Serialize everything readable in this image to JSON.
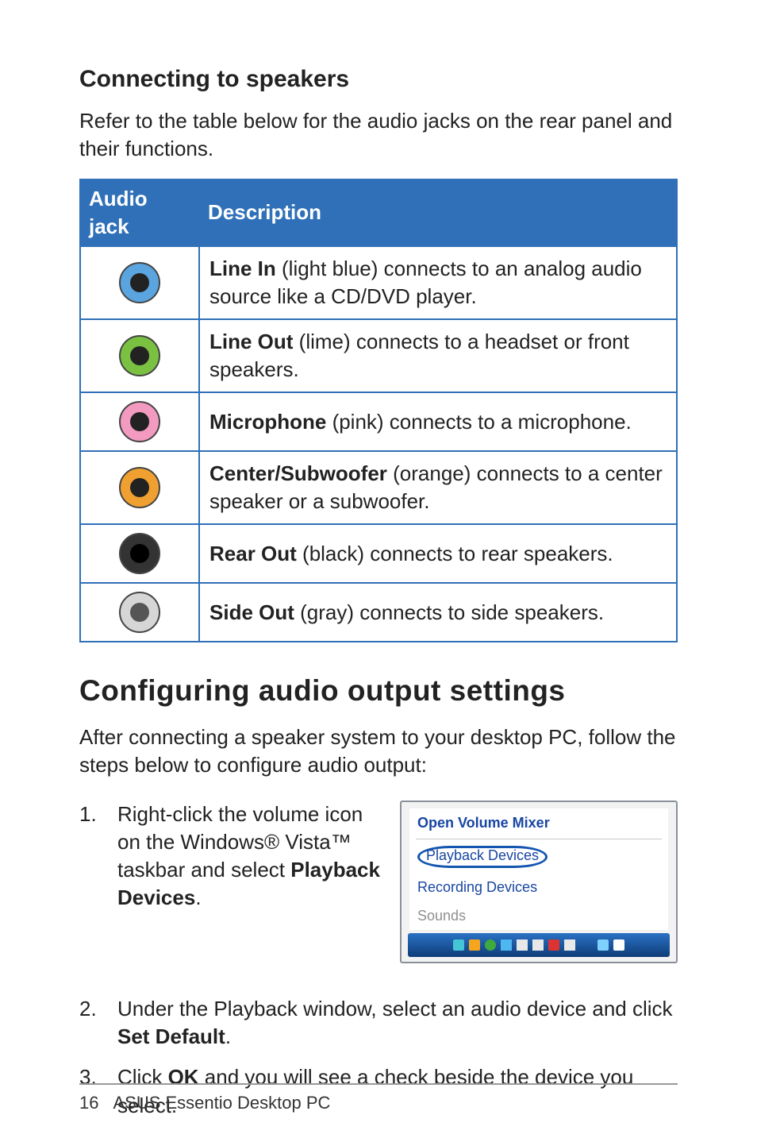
{
  "headings": {
    "connecting": "Connecting to speakers",
    "configuring": "Configuring audio output settings"
  },
  "paragraphs": {
    "refer": "Refer to the table below for the audio jacks on the rear panel and their functions.",
    "after": "After connecting a speaker system to your desktop PC, follow the steps below to configure audio output:"
  },
  "table": {
    "col_jack": "Audio jack",
    "col_desc": "Description",
    "rows": [
      {
        "bold": "Line In",
        "rest": " (light blue) connects to an analog audio source like a CD/DVD player."
      },
      {
        "bold": "Line Out",
        "rest": " (lime) connects to a headset or front speakers."
      },
      {
        "bold": "Microphone",
        "rest": " (pink) connects to a microphone."
      },
      {
        "bold": "Center/Subwoofer",
        "rest": " (orange) connects to a center speaker or a subwoofer."
      },
      {
        "bold": "Rear Out",
        "rest": " (black) connects to rear speakers."
      },
      {
        "bold": "Side Out",
        "rest": " (gray) connects to side speakers."
      }
    ]
  },
  "steps": {
    "s1_num": "1.",
    "s1a": "Right-click the volume icon on the Windows® Vista™ taskbar and select ",
    "s1b": "Playback Devices",
    "s1c": ".",
    "s2_num": "2.",
    "s2a": "Under the Playback window, select an audio device and click ",
    "s2b": "Set Default",
    "s2c": ".",
    "s3_num": "3.",
    "s3a": "Click ",
    "s3b": "OK",
    "s3c": " and you will see a check beside the device you select."
  },
  "menu": {
    "open_mixer": "Open Volume Mixer",
    "playback": "Playback Devices",
    "recording": "Recording Devices",
    "sounds": "Sounds"
  },
  "footer": {
    "page": "16",
    "product": "ASUS Essentio Desktop PC"
  }
}
